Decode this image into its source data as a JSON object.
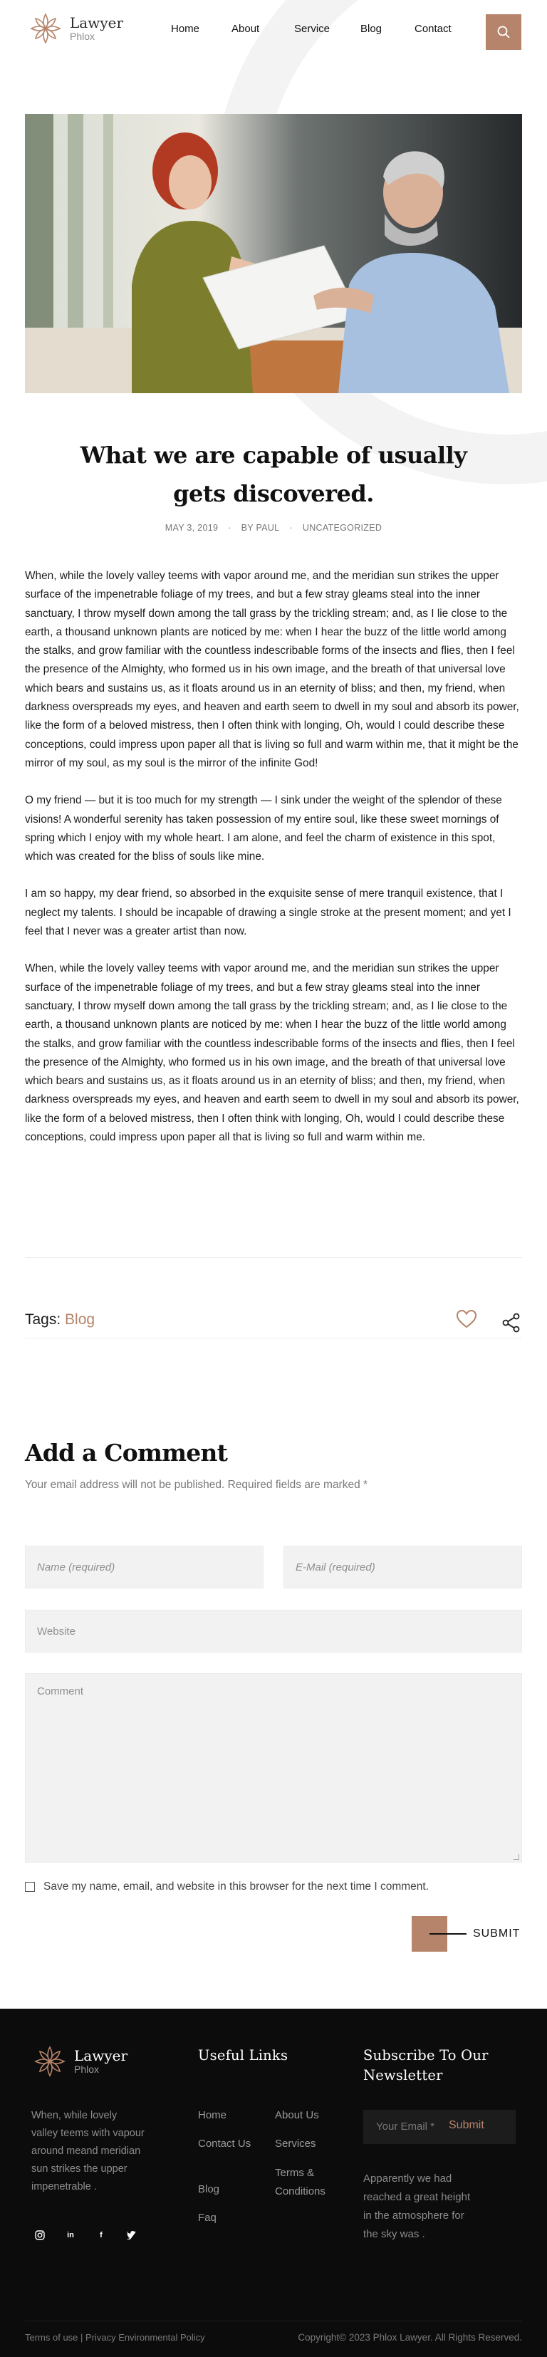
{
  "header": {
    "logo_name": "Lawyer",
    "logo_sub": "Phlox",
    "nav": [
      {
        "label": "Home"
      },
      {
        "label": "About"
      },
      {
        "label": "Service"
      },
      {
        "label": "Blog"
      },
      {
        "label": "Contact"
      }
    ],
    "search_icon": "search-icon",
    "accent_color": "#b5846a"
  },
  "post": {
    "title": "What we are capable of usually gets discovered.",
    "date": "MAY 3, 2019",
    "author": "BY PAUL",
    "category": "UNCATEGORIZED",
    "paragraphs": [
      "When, while the lovely valley teems with vapor around me, and the meridian sun strikes the upper surface of the impenetrable foliage of my trees, and but a few stray gleams steal into the inner sanctuary, I throw myself down among the tall grass by the trickling stream; and, as I lie close to the earth, a thousand unknown plants are noticed by me: when I hear the buzz of the little world among the stalks, and grow familiar with the countless indescribable forms of the insects and flies, then I feel the presence of the Almighty, who formed us in his own image, and the breath of that universal love which bears and sustains us, as it floats around us in an eternity of bliss; and then, my friend, when darkness overspreads my eyes, and heaven and earth seem to dwell in my soul and absorb its power, like the form of a beloved mistress, then I often think with longing, Oh, would I could describe these conceptions, could impress upon paper all that is living so full and warm within me, that it might be the mirror of my soul, as my soul is the mirror of the infinite God!",
      "O my friend — but it is too much for my strength — I sink under the weight of the splendor of these visions! A wonderful serenity has taken possession of my entire soul, like these sweet mornings of spring which I enjoy with my whole heart. I am alone, and feel the charm of existence in this spot, which was created for the bliss of souls like mine.",
      "I am so happy, my dear friend, so absorbed in the exquisite sense of mere tranquil existence, that I neglect my talents. I should be incapable of drawing a single stroke at the present moment; and yet I feel that I never was a greater artist than now.",
      "When, while the lovely valley teems with vapor around me, and the meridian sun strikes the upper surface of the impenetrable foliage of my trees, and but a few stray gleams steal into the inner sanctuary, I throw myself down among the tall grass by the trickling stream; and, as I lie close to the earth, a thousand unknown plants are noticed by me: when I hear the buzz of the little world among the stalks, and grow familiar with the countless indescribable forms of the insects and flies, then I feel the presence of the Almighty, who formed us in his own image, and the breath of that universal love which bears and sustains us, as it floats around us in an eternity of bliss; and then, my friend, when darkness overspreads my eyes, and heaven and earth seem to dwell in my soul and absorb its power, like the form of a beloved mistress, then I often think with longing, Oh, would I could describe these conceptions, could impress upon paper all that is living so full and warm within me."
    ],
    "tags_label": "Tags:",
    "tag": "Blog"
  },
  "comments": {
    "title": "Add a Comment",
    "note": "Your email address will not be published. Required fields are marked *",
    "name_placeholder": "Name (required)",
    "email_placeholder": "E-Mail (required)",
    "website_placeholder": "Website",
    "comment_placeholder": "Comment",
    "save_label": "Save my name, email, and website in this browser for the next time I comment.",
    "submit_label": "SUBMIT"
  },
  "footer": {
    "logo_name": "Lawyer",
    "logo_sub": "Phlox",
    "about": "When, while lovely valley teems with vapour around meand meridian sun strikes the upper impenetrable .",
    "social": [
      "instagram-icon",
      "linkedin-icon",
      "facebook-icon",
      "twitter-icon"
    ],
    "links_heading": "Useful Links",
    "links": {
      "home": "Home",
      "about": "About Us",
      "contact": "Contact Us",
      "services": "Services",
      "blog": "Blog",
      "terms": "Terms & Conditions",
      "faq": "Faq"
    },
    "newsletter_heading": "Subscribe To Our Newsletter",
    "email_placeholder": "Your Email *",
    "submit_label": "Submit",
    "newsletter_note": "Apparently we had reached a great height in the atmosphere for the sky was .",
    "legal": "Terms of use | Privacy Environmental Policy",
    "copyright": "Copyright© 2023 Phlox Lawyer. All Rights Reserved."
  }
}
